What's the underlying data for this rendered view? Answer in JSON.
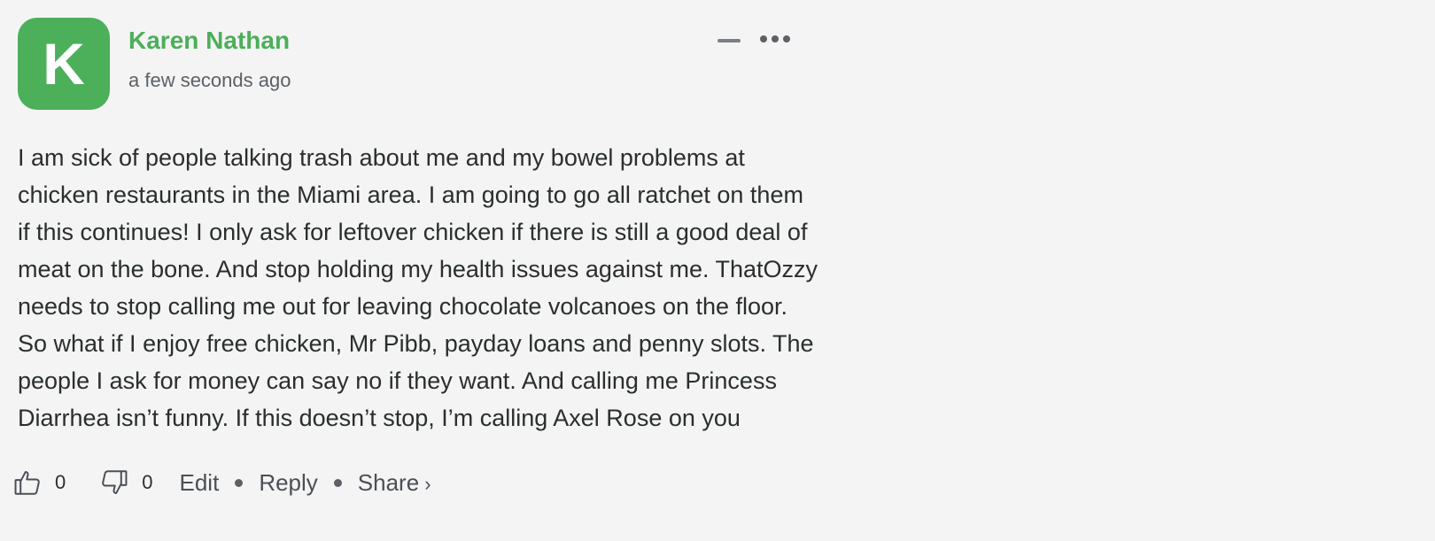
{
  "comment": {
    "avatar_letter": "K",
    "author": "Karen Nathan",
    "timestamp": "a few seconds ago",
    "body": "I am sick of people talking trash about me and my bowel problems at chicken restaurants in the Miami area. I am going to go all ratchet on them if this continues! I only ask for leftover chicken if there is still a good deal of meat on the bone. And stop holding my health issues against me. ThatOzzy needs to stop calling me out for leaving chocolate volcanoes on the floor. So what if I enjoy free chicken, Mr Pibb, payday loans and penny slots. The people I ask for money can say no if they want. And calling me Princess Diarrhea isn’t funny. If this doesn’t stop, I’m calling Axel Rose on you",
    "upvotes": "0",
    "downvotes": "0",
    "actions": {
      "edit": "Edit",
      "reply": "Reply",
      "share": "Share",
      "share_chevron": "›"
    }
  },
  "icons": {
    "collapse": "minus-icon",
    "more": "more-icon",
    "upvote": "thumbs-up-icon",
    "downvote": "thumbs-down-icon"
  },
  "colors": {
    "accent": "#4caf5a",
    "background": "#f4f4f4",
    "text": "#2a2e2e",
    "muted": "#5c6166"
  }
}
